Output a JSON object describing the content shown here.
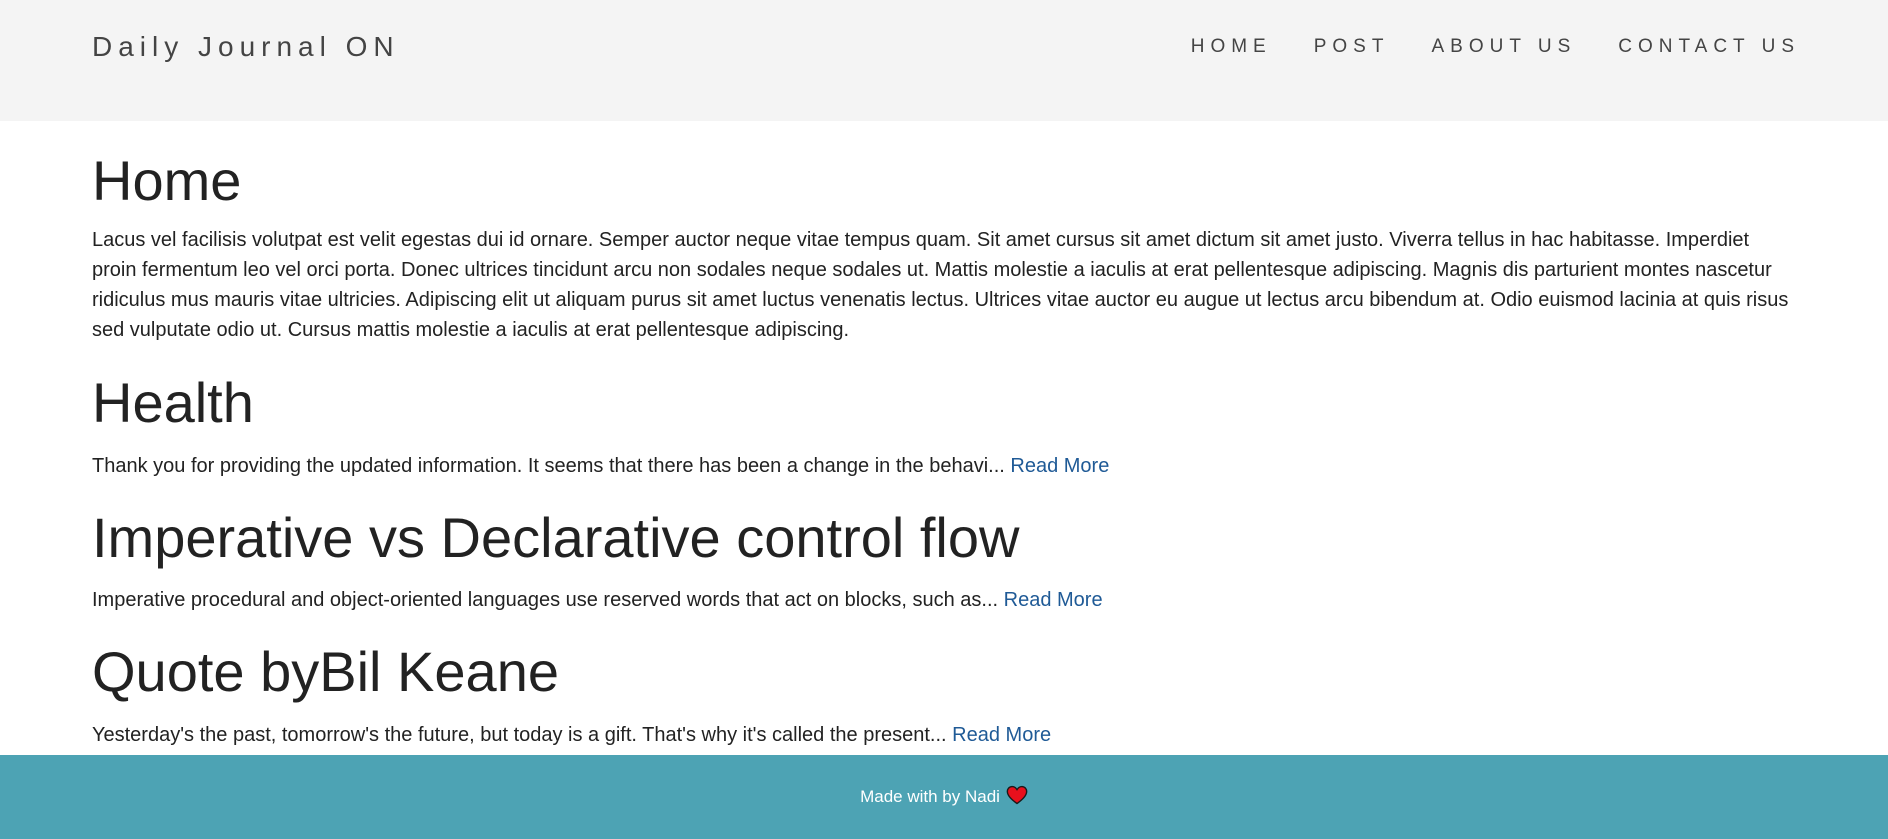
{
  "header": {
    "brand": "Daily Journal ON",
    "nav": [
      "HOME",
      "POST",
      "ABOUT US",
      "CONTACT US"
    ]
  },
  "home": {
    "title": "Home",
    "text": "Lacus vel facilisis volutpat est velit egestas dui id ornare. Semper auctor neque vitae tempus quam. Sit amet cursus sit amet dictum sit amet justo. Viverra tellus in hac habitasse. Imperdiet proin fermentum leo vel orci porta. Donec ultrices tincidunt arcu non sodales neque sodales ut. Mattis molestie a iaculis at erat pellentesque adipiscing. Magnis dis parturient montes nascetur ridiculus mus mauris vitae ultricies. Adipiscing elit ut aliquam purus sit amet luctus venenatis lectus. Ultrices vitae auctor eu augue ut lectus arcu bibendum at. Odio euismod lacinia at quis risus sed vulputate odio ut. Cursus mattis molestie a iaculis at erat pellentesque adipiscing."
  },
  "posts": [
    {
      "title": "Health",
      "excerpt": "Thank you for providing the updated information. It seems that there has been a change in the behavi...",
      "read_more": "Read More"
    },
    {
      "title": "Imperative vs Declarative control flow",
      "excerpt": "Imperative procedural and object-oriented languages use reserved words that act on blocks, such as...",
      "read_more": "Read More"
    },
    {
      "title": "Quote byBil Keane",
      "excerpt": "Yesterday's the past, tomorrow's the future, but today is a gift. That's why it's called the present...",
      "read_more": "Read More"
    }
  ],
  "footer": {
    "text": "Made with by Nadi",
    "icon": "heart-icon",
    "heart_color": "#e8101c"
  },
  "colors": {
    "header_bg": "#f4f4f4",
    "footer_bg": "#4da3b4",
    "link": "#1f5a96"
  }
}
